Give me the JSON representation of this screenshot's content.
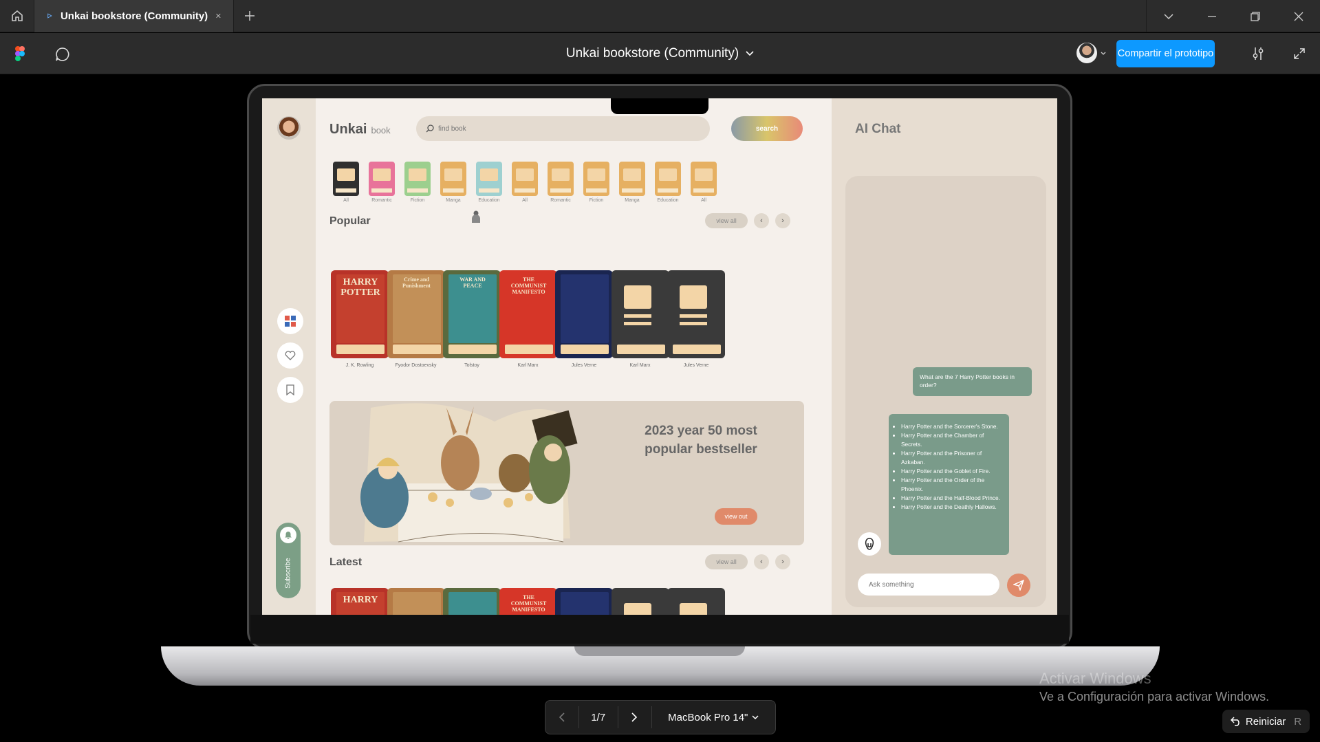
{
  "window": {
    "tab_title": "Unkai bookstore (Community)",
    "file_title": "Unkai bookstore (Community)",
    "share_label": "Compartir el prototipo"
  },
  "player": {
    "page_indicator": "1/7",
    "device": "MacBook Pro 14\"",
    "restart_label": "Reiniciar",
    "restart_key": "R"
  },
  "watermark": {
    "line1": "Activar Windows",
    "line2": "Ve a Configuración para activar Windows."
  },
  "app": {
    "brand": "Unkai",
    "brand_sub": "book",
    "search_placeholder": "find book",
    "search_button": "search",
    "categories": [
      "All",
      "Romantic",
      "Fiction",
      "Manga",
      "Education",
      "All",
      "Romantic",
      "Fiction",
      "Manga",
      "Education",
      "All"
    ],
    "popular_title": "Popular",
    "latest_title": "Latest",
    "view_all": "view all",
    "popular_books": [
      {
        "author": "J. K. Rowling",
        "cover_title": "HARRY POTTER"
      },
      {
        "author": "Fyodor Dostoevsky",
        "cover_title": "Crime and Punishment"
      },
      {
        "author": "Tolstoy",
        "cover_title": "WAR AND PEACE"
      },
      {
        "author": "Karl Marx",
        "cover_title": "THE COMMUNIST MANIFESTO"
      },
      {
        "author": "Jules Verne",
        "cover_title": ""
      },
      {
        "author": "Karl Marx",
        "cover_title": ""
      },
      {
        "author": "Jules Verne",
        "cover_title": ""
      }
    ],
    "latest_covers": [
      "HARRY",
      "",
      "",
      "THE COMMUNIST MANIFESTO",
      "",
      "",
      ""
    ],
    "banner_heading": "2023 year 50 most popular bestseller",
    "banner_button": "view out",
    "subscribe_label": "Subscribe"
  },
  "chat": {
    "title": "AI Chat",
    "question": "What are the 7 Harry Potter books in order?",
    "answers": [
      "Harry Potter and the Sorcerer's Stone.",
      "Harry Potter and the Chamber of Secrets.",
      "Harry Potter and the Prisoner of Azkaban.",
      "Harry Potter and the Goblet of Fire.",
      "Harry Potter and the Order of the Phoenix.",
      "Harry Potter and the Half-Blood Prince.",
      "Harry Potter and the Deathly Hallows."
    ],
    "input_placeholder": "Ask something"
  },
  "colors": {
    "accent": "#0d99ff",
    "chat_bubble": "#7a9b8a",
    "coral": "#e08a6a"
  }
}
